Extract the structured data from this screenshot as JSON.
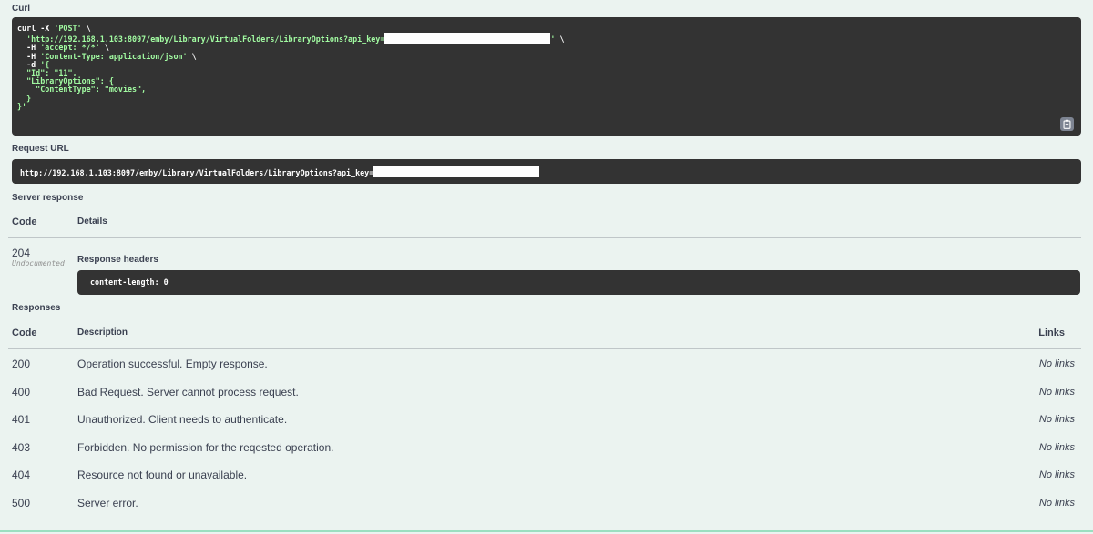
{
  "curl": {
    "label": "Curl",
    "line1": "curl -X ",
    "line1_str": "'POST'",
    "line1_end": " \\",
    "line2_str": "  'http://192.168.1.103:8097/emby/Library/VirtualFolders/LibraryOptions?api_key=",
    "line2_end_str": "'",
    "line2_end": " \\",
    "line3": "  -H ",
    "line3_str": "'accept: */*'",
    "line3_end": " \\",
    "line4": "  -H ",
    "line4_str": "'Content-Type: application/json'",
    "line4_end": " \\",
    "line5": "  -d ",
    "line5_str": "'{",
    "line6_str": "  \"Id\": \"11\",",
    "line7_str": "  \"LibraryOptions\": {",
    "line8_str": "    \"ContentType\": \"movies\",",
    "line9_str": "  }",
    "line10_str": "}'",
    "copy_icon": "clipboard-icon"
  },
  "request_url": {
    "label": "Request URL",
    "value": "http://192.168.1.103:8097/emby/Library/VirtualFolders/LibraryOptions?api_key="
  },
  "server_response": {
    "label": "Server response",
    "col_code": "Code",
    "col_details": "Details",
    "code": "204",
    "undocumented": "Undocumented",
    "headers_label": "Response headers",
    "headers_value": "content-length: 0"
  },
  "responses": {
    "label": "Responses",
    "col_code": "Code",
    "col_description": "Description",
    "col_links": "Links",
    "rows": [
      {
        "code": "200",
        "description": "Operation successful. Empty response.",
        "links": "No links"
      },
      {
        "code": "400",
        "description": "Bad Request. Server cannot process request.",
        "links": "No links"
      },
      {
        "code": "401",
        "description": "Unauthorized. Client needs to authenticate.",
        "links": "No links"
      },
      {
        "code": "403",
        "description": "Forbidden. No permission for the reqested operation.",
        "links": "No links"
      },
      {
        "code": "404",
        "description": "Resource not found or unavailable.",
        "links": "No links"
      },
      {
        "code": "500",
        "description": "Server error.",
        "links": "No links"
      }
    ]
  },
  "colors": {
    "background": "#ebf3f0",
    "code_bg": "#333333",
    "string": "#a2fca2",
    "accent": "#49cc90"
  }
}
